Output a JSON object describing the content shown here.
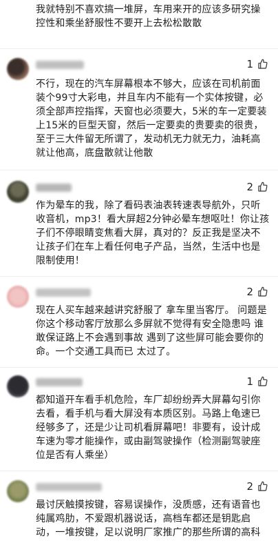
{
  "comments": [
    {
      "text": "我就特别不喜欢搞一堆屏，车用来开的应该多研究操控性和乘坐舒服性不要开上去松松散散",
      "likes": ""
    },
    {
      "text": "不行，现在的汽车屏幕根本不够大，应该在司机前面装个99寸大彩电，并且车内不能有一个实体按键，必须全部声控指挥，天窗也必须要大，5米的车一定要装上15米的巨型天窗，然后一定要卖的贵要卖的很贵，至于三大件留无所谓了，发动机无力就无力，油耗高就让他高，底盘散就让他散",
      "likes": "1"
    },
    {
      "text": "作为晕车的我，除了看码表油表转速表导航外，只听收音机，mp3！看大屏超2分钟必晕车想呕吐！你让孩子们不停眼睛变焦看大屏，真对的？反正我是坚决不让孩子们在车上看任何电子产品，当然，生活中也是限制使用！",
      "likes": "2"
    },
    {
      "text": "现在人买车越来越讲究舒服了 拿车里当客厅。 问题是你这个移动客厅放那么多屏就不觉得有安全隐患吗 谁敢保证路上不会遇到事故 遇到了这些屏可能会要你的命。一个交通工具而已 太过了。",
      "likes": "2"
    },
    {
      "text": "都知道开车看手机危险，车厂却纷纷弄大屏幕勾引你去看，看手机与看大屏没有本质区别。马路上龟速已经够多了，还是少让司机看屏幕吧！非要有，设计成车速为零才能操作，或由副驾驶操作（检测副驾驶座位是否有人乘坐）",
      "likes": "1"
    },
    {
      "text": "最讨厌触摸按键，容易误操作，没质感，还有语音也纯属鸡肋，不爱跟机器说话，高档车都还是钥匙启动，一堆按键，足以说明厂家推广的那些所谓的高科",
      "likes": "2"
    }
  ],
  "icons": {
    "like": "thumbs-up-icon"
  }
}
